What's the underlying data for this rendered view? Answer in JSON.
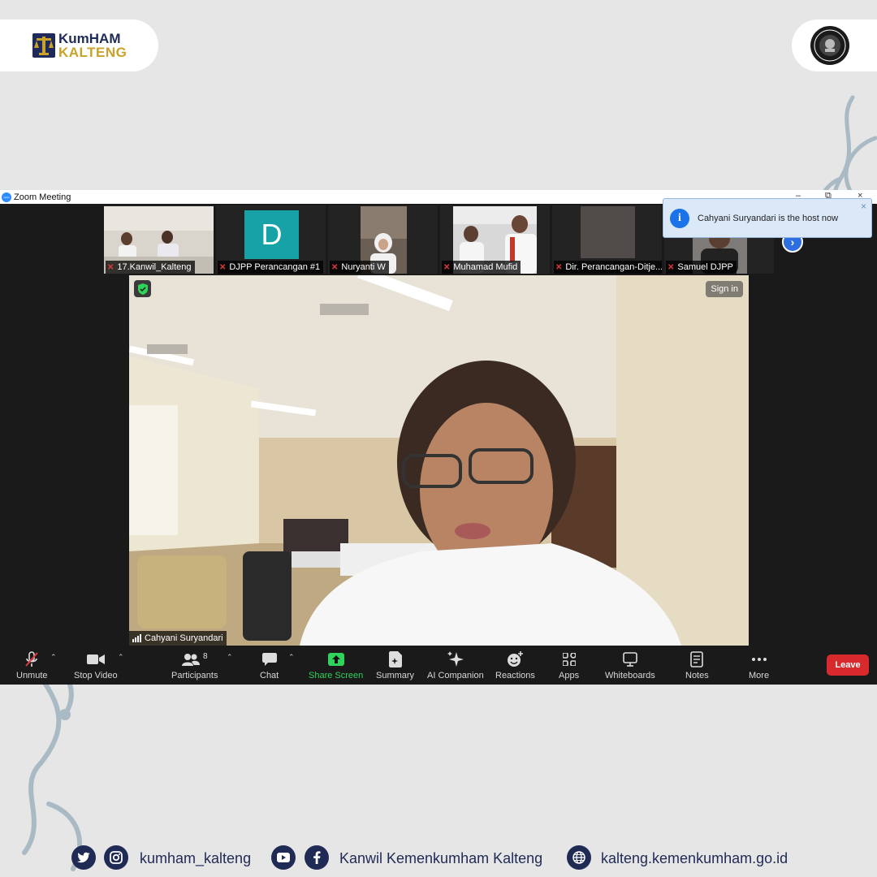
{
  "branding": {
    "logo_line1": "KumHAM",
    "logo_line2": "KALTENG"
  },
  "window": {
    "title": "Zoom Meeting",
    "minimize_glyph": "–",
    "maximize_glyph": "⧉",
    "close_glyph": "×"
  },
  "notification": {
    "message": "Cahyani Suryandari is the host now",
    "icon": "info-icon",
    "close_glyph": "×"
  },
  "thumbnails": [
    {
      "name": "17.Kanwil_Kalteng",
      "muted": true
    },
    {
      "name": "DJPP Perancangan #1",
      "muted": true,
      "avatar_letter": "D"
    },
    {
      "name": "Nuryanti W",
      "muted": true
    },
    {
      "name": "Muhamad Mufid",
      "muted": true
    },
    {
      "name": "Dir. Perancangan-Ditje...",
      "muted": true
    },
    {
      "name": "Samuel DJPP",
      "muted": true
    }
  ],
  "main_video": {
    "speaker": "Cahyani Suryandari",
    "sign_in_label": "Sign in"
  },
  "toolbar": {
    "unmute": "Unmute",
    "stop_video": "Stop Video",
    "participants": "Participants",
    "participants_count": "8",
    "chat": "Chat",
    "share_screen": "Share Screen",
    "summary": "Summary",
    "ai_companion": "AI Companion",
    "reactions": "Reactions",
    "apps": "Apps",
    "whiteboards": "Whiteboards",
    "notes": "Notes",
    "more": "More",
    "leave": "Leave"
  },
  "footer": {
    "instagram_handle": "kumham_kalteng",
    "facebook_page": "Kanwil Kemenkumham Kalteng",
    "website": "kalteng.kemenkumham.go.id"
  },
  "colors": {
    "navy": "#1f2a55",
    "gold": "#c9a227",
    "share_green": "#2fd35b",
    "leave_red": "#d8292c"
  }
}
